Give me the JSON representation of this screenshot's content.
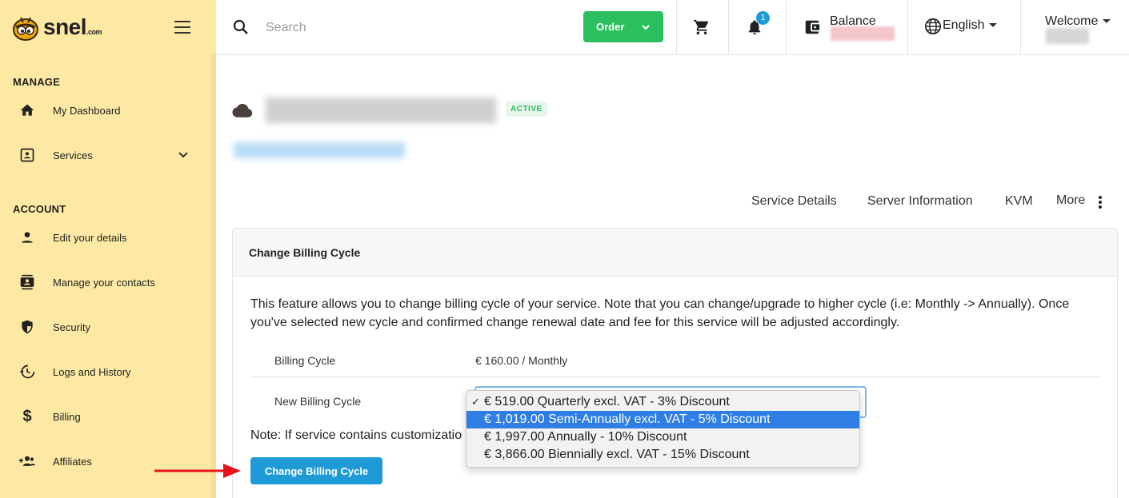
{
  "brand": {
    "name": "snel",
    "suffix": ".com"
  },
  "sidebar": {
    "sections": [
      {
        "label": "MANAGE"
      },
      {
        "label": "ACCOUNT"
      }
    ],
    "items": [
      {
        "label": "My Dashboard",
        "icon": "home-icon"
      },
      {
        "label": "Services",
        "icon": "id-card-icon"
      },
      {
        "label": "Edit your details",
        "icon": "person-icon"
      },
      {
        "label": "Manage your contacts",
        "icon": "contacts-icon"
      },
      {
        "label": "Security",
        "icon": "shield-icon"
      },
      {
        "label": "Logs and History",
        "icon": "history-icon"
      },
      {
        "label": "Billing",
        "icon": "dollar-icon"
      },
      {
        "label": "Affiliates",
        "icon": "group-add-icon"
      }
    ]
  },
  "topbar": {
    "search_placeholder": "Search",
    "order_label": "Order",
    "notifications_count": "1",
    "balance_label": "Balance",
    "language": "English",
    "welcome": "Welcome"
  },
  "service": {
    "status": "ACTIVE"
  },
  "tabs": [
    "Service Details",
    "Server Information",
    "KVM",
    "More"
  ],
  "card": {
    "title": "Change Billing Cycle",
    "description": "This feature allows you to change billing cycle of your service. Note that you can change/upgrade to higher cycle (i.e: Monthly -> Annually). Once you've selected new cycle and confirmed change renewal date and fee for this service will be adjusted accordingly.",
    "billing_cycle_label": "Billing Cycle",
    "billing_cycle_value": "€ 160.00 / Monthly",
    "new_cycle_label": "New Billing Cycle",
    "note": "Note: If service contains customizatio",
    "submit_label": "Change Billing Cycle"
  },
  "dropdown": {
    "options": [
      "€ 519.00 Quarterly excl. VAT - 3% Discount",
      "€ 1,019.00 Semi-Annually excl. VAT - 5% Discount",
      "€ 1,997.00 Annually - 10% Discount",
      "€ 3,866.00 Biennially excl. VAT - 15% Discount"
    ],
    "checked_index": 0,
    "highlighted_index": 1
  },
  "colors": {
    "sidebar_bg": "#fde9a4",
    "order_green": "#2bbf5f",
    "primary_blue": "#1e9ad6",
    "highlight_blue": "#2f7ee6",
    "annotation_arrow": "#e8141c"
  }
}
